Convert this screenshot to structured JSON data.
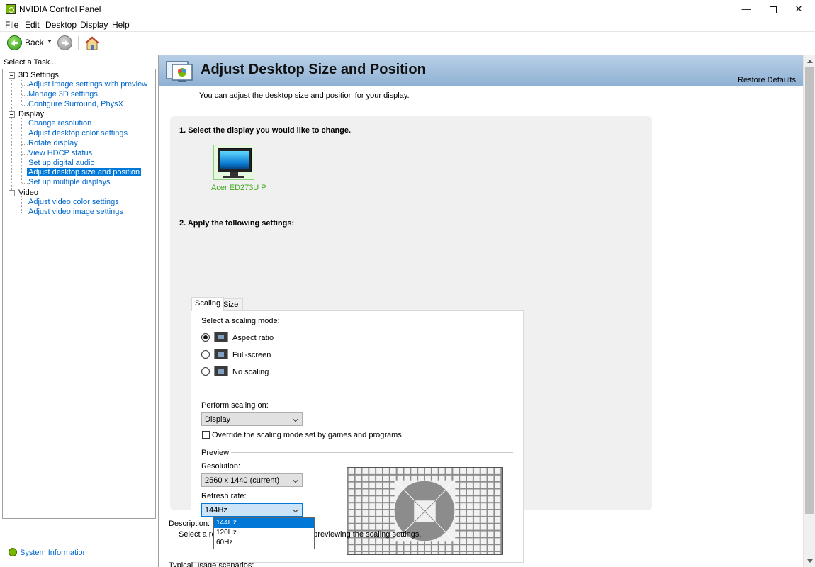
{
  "window": {
    "title": "NVIDIA Control Panel",
    "controls": {
      "minimize": "—",
      "maximize": "",
      "close": "✕"
    }
  },
  "menu": [
    "File",
    "Edit",
    "Desktop",
    "Display",
    "Help"
  ],
  "toolbar": {
    "back_label": "Back"
  },
  "left": {
    "header": "Select a Task...",
    "tree": [
      {
        "label": "3D Settings",
        "children": [
          "Adjust image settings with preview",
          "Manage 3D settings",
          "Configure Surround, PhysX"
        ]
      },
      {
        "label": "Display",
        "children": [
          "Change resolution",
          "Adjust desktop color settings",
          "Rotate display",
          "View HDCP status",
          "Set up digital audio",
          "Adjust desktop size and position",
          "Set up multiple displays"
        ]
      },
      {
        "label": "Video",
        "children": [
          "Adjust video color settings",
          "Adjust video image settings"
        ]
      }
    ],
    "selected": "Adjust desktop size and position",
    "system_info": "System Information"
  },
  "page": {
    "title": "Adjust Desktop Size and Position",
    "restore_defaults": "Restore Defaults",
    "intro": "You can adjust the desktop size and position for your display.",
    "step1": "1. Select the display you would like to change.",
    "display_name": "Acer ED273U P",
    "step2": "2. Apply the following settings:",
    "tabs": [
      "Scaling",
      "Size"
    ],
    "active_tab": "Scaling",
    "scaling_mode_label": "Select a scaling mode:",
    "modes": [
      {
        "label": "Aspect ratio",
        "selected": true
      },
      {
        "label": "Full-screen",
        "selected": false
      },
      {
        "label": "No scaling",
        "selected": false
      }
    ],
    "perform_label": "Perform scaling on:",
    "perform_value": "Display",
    "override_label": "Override the scaling mode set by games and programs",
    "override_checked": false,
    "preview_label": "Preview",
    "resolution_label": "Resolution:",
    "resolution_value": "2560 x 1440 (current)",
    "refresh_label": "Refresh rate:",
    "refresh_value": "144Hz",
    "refresh_options": [
      "144Hz",
      "120Hz",
      "60Hz"
    ],
    "description_label": "Description:",
    "description_text": "Select a resolution and refresh rate for previewing the scaling settings.",
    "usage_label": "Typical usage scenarios:"
  },
  "colors": {
    "link": "#0066cc",
    "selection": "#0078d7",
    "nvidia_green": "#76b900",
    "banner_top": "#b8cfe6",
    "banner_bottom": "#8fb1d4",
    "display_label": "#3ca81b"
  }
}
